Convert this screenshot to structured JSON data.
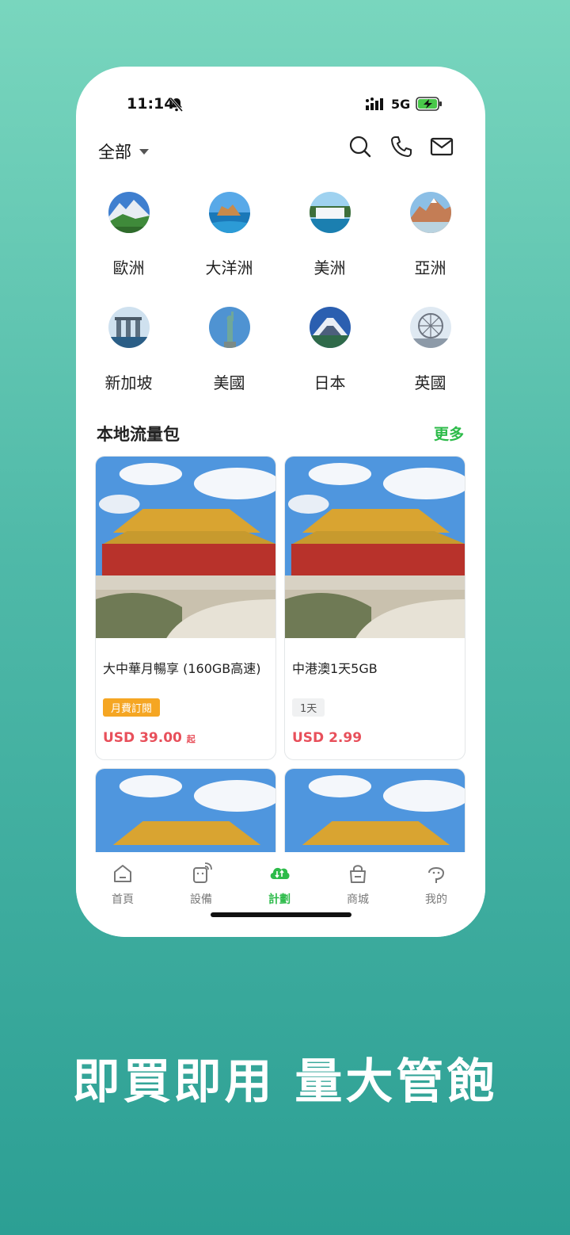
{
  "status_bar": {
    "time": "11:14",
    "network": "5G"
  },
  "header": {
    "region_selector": "全部",
    "icons": [
      "search-icon",
      "phone-icon",
      "mail-icon"
    ]
  },
  "destinations": [
    {
      "label": "歐洲",
      "icon": "europe-mountain-thumb"
    },
    {
      "label": "大洋洲",
      "icon": "oceania-coast-thumb"
    },
    {
      "label": "美洲",
      "icon": "americas-waterfall-thumb"
    },
    {
      "label": "亞洲",
      "icon": "asia-mountain-thumb"
    },
    {
      "label": "新加坡",
      "icon": "singapore-marina-thumb"
    },
    {
      "label": "美國",
      "icon": "usa-statue-thumb"
    },
    {
      "label": "日本",
      "icon": "japan-fuji-thumb"
    },
    {
      "label": "英國",
      "icon": "uk-eye-thumb"
    }
  ],
  "local_packages": {
    "title": "本地流量包",
    "more": "更多",
    "cards": [
      {
        "name": "大中華月暢享 (160GB高速)",
        "tag": "月費訂閱",
        "price": "USD 39.00",
        "price_suffix": "起"
      },
      {
        "name": "中港澳1天5GB",
        "tag": "1天",
        "price": "USD 2.99",
        "price_suffix": ""
      }
    ]
  },
  "tabbar": {
    "tabs": [
      {
        "label": "首頁",
        "icon": "home-icon"
      },
      {
        "label": "設備",
        "icon": "device-icon"
      },
      {
        "label": "計劃",
        "icon": "plan-cloud-icon",
        "active": true
      },
      {
        "label": "商城",
        "icon": "shop-bag-icon"
      },
      {
        "label": "我的",
        "icon": "profile-icon"
      }
    ]
  },
  "slogan": "即買即用  量大管飽",
  "colors": {
    "accent": "#2dbb4a",
    "price": "#e8505b",
    "tag_orange": "#f5a623",
    "bg_top": "#79d6be",
    "bg_bottom": "#2c9f94"
  }
}
